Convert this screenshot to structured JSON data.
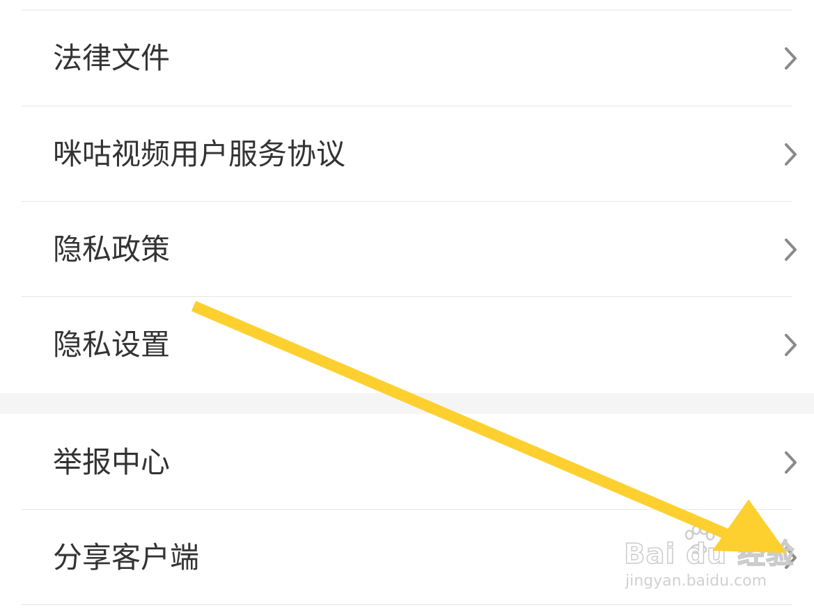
{
  "menu": {
    "items": [
      {
        "label": "法律文件"
      },
      {
        "label": "咪咕视频用户服务协议"
      },
      {
        "label": "隐私政策"
      },
      {
        "label": "隐私设置"
      },
      {
        "label": "举报中心"
      },
      {
        "label": "分享客户端"
      }
    ]
  },
  "icons": {
    "row_action": "chevron-right-icon",
    "annotation": "arrow-icon"
  },
  "watermark": {
    "brand": "Bai du 经验",
    "url": "jingyan.baidu.com"
  },
  "colors": {
    "annotation_arrow": "#FDD02F",
    "chevron": "#8a8a8a",
    "divider": "#e6e6e6",
    "section_gap": "#f5f5f5",
    "text": "#333333"
  }
}
